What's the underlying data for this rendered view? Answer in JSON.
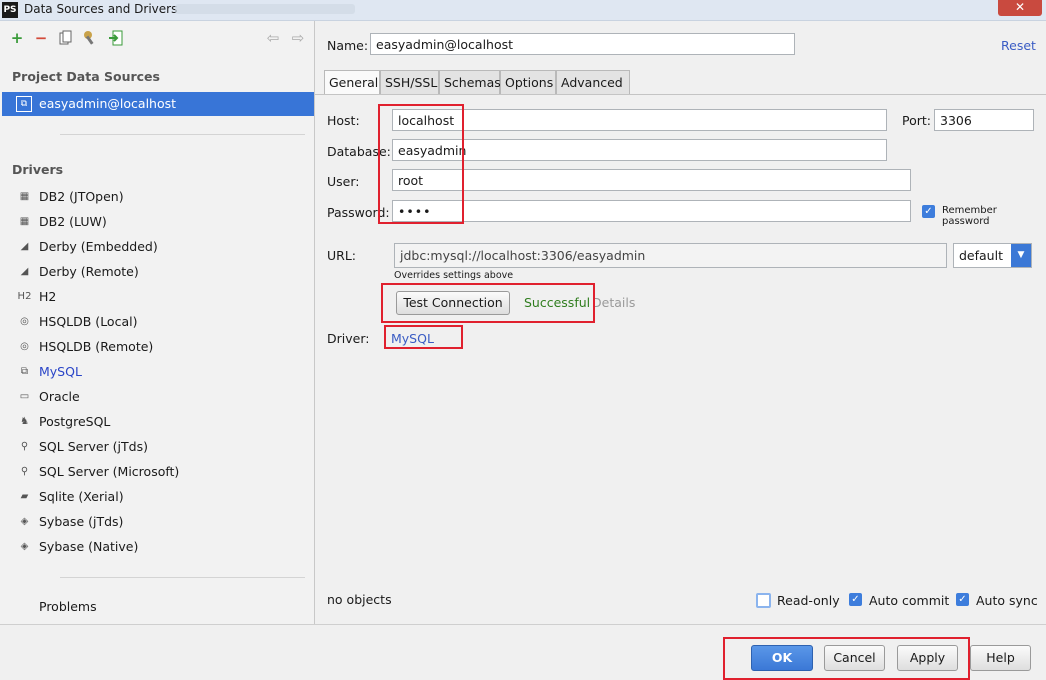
{
  "window": {
    "title": "Data Sources and Drivers",
    "app_icon": "PS",
    "close_glyph": "✕"
  },
  "toolbar": {
    "add": "+",
    "remove": "−",
    "back": "⇦",
    "forward": "⇨"
  },
  "sidebar": {
    "project_title": "Project Data Sources",
    "datasource": "easyadmin@localhost",
    "drivers_title": "Drivers",
    "drivers": [
      {
        "label": "DB2 (JTOpen)",
        "icon": "db2-icon",
        "glyph": "▦"
      },
      {
        "label": "DB2 (LUW)",
        "icon": "db2-icon",
        "glyph": "▦"
      },
      {
        "label": "Derby (Embedded)",
        "icon": "derby-hat-icon",
        "glyph": "◢"
      },
      {
        "label": "Derby (Remote)",
        "icon": "derby-hat-icon",
        "glyph": "◢"
      },
      {
        "label": "H2",
        "icon": "h2-icon",
        "glyph": "H2"
      },
      {
        "label": "HSQLDB (Local)",
        "icon": "hsqldb-icon",
        "glyph": "◎"
      },
      {
        "label": "HSQLDB (Remote)",
        "icon": "hsqldb-icon",
        "glyph": "◎"
      },
      {
        "label": "MySQL",
        "icon": "mysql-icon",
        "glyph": "⧉"
      },
      {
        "label": "Oracle",
        "icon": "oracle-icon",
        "glyph": "▭"
      },
      {
        "label": "PostgreSQL",
        "icon": "postgresql-icon",
        "glyph": "♞"
      },
      {
        "label": "SQL Server (jTds)",
        "icon": "sqlserver-icon",
        "glyph": "⚲"
      },
      {
        "label": "SQL Server (Microsoft)",
        "icon": "sqlserver-icon",
        "glyph": "⚲"
      },
      {
        "label": "Sqlite (Xerial)",
        "icon": "sqlite-icon",
        "glyph": "▰"
      },
      {
        "label": "Sybase (jTds)",
        "icon": "sybase-icon",
        "glyph": "◈"
      },
      {
        "label": "Sybase (Native)",
        "icon": "sybase-icon",
        "glyph": "◈"
      }
    ],
    "problems": "Problems"
  },
  "main": {
    "name_label": "Name:",
    "name_value": "easyadmin@localhost",
    "reset": "Reset",
    "tabs": [
      "General",
      "SSH/SSL",
      "Schemas",
      "Options",
      "Advanced"
    ],
    "host_label": "Host:",
    "host_value": "localhost",
    "port_label": "Port:",
    "port_value": "3306",
    "database_label": "Database:",
    "database_value": "easyadmin",
    "user_label": "User:",
    "user_value": "root",
    "password_label": "Password:",
    "password_value": "••••",
    "remember_password": "Remember password",
    "url_label": "URL:",
    "url_value": "jdbc:mysql://localhost:3306/easyadmin",
    "url_mode": "default",
    "url_hint": "Overrides settings above",
    "test_connection": "Test Connection",
    "test_result": "Successful",
    "details": "Details",
    "driver_label": "Driver:",
    "driver_value": "MySQL",
    "no_objects": "no objects",
    "read_only": "Read-only",
    "auto_commit": "Auto commit",
    "auto_sync": "Auto sync"
  },
  "footer": {
    "ok": "OK",
    "cancel": "Cancel",
    "apply": "Apply",
    "help": "Help"
  },
  "colors": {
    "accent": "#3875d7",
    "success": "#2f7d1e",
    "highlight": "#e0202e",
    "link": "#3a5cc4"
  }
}
